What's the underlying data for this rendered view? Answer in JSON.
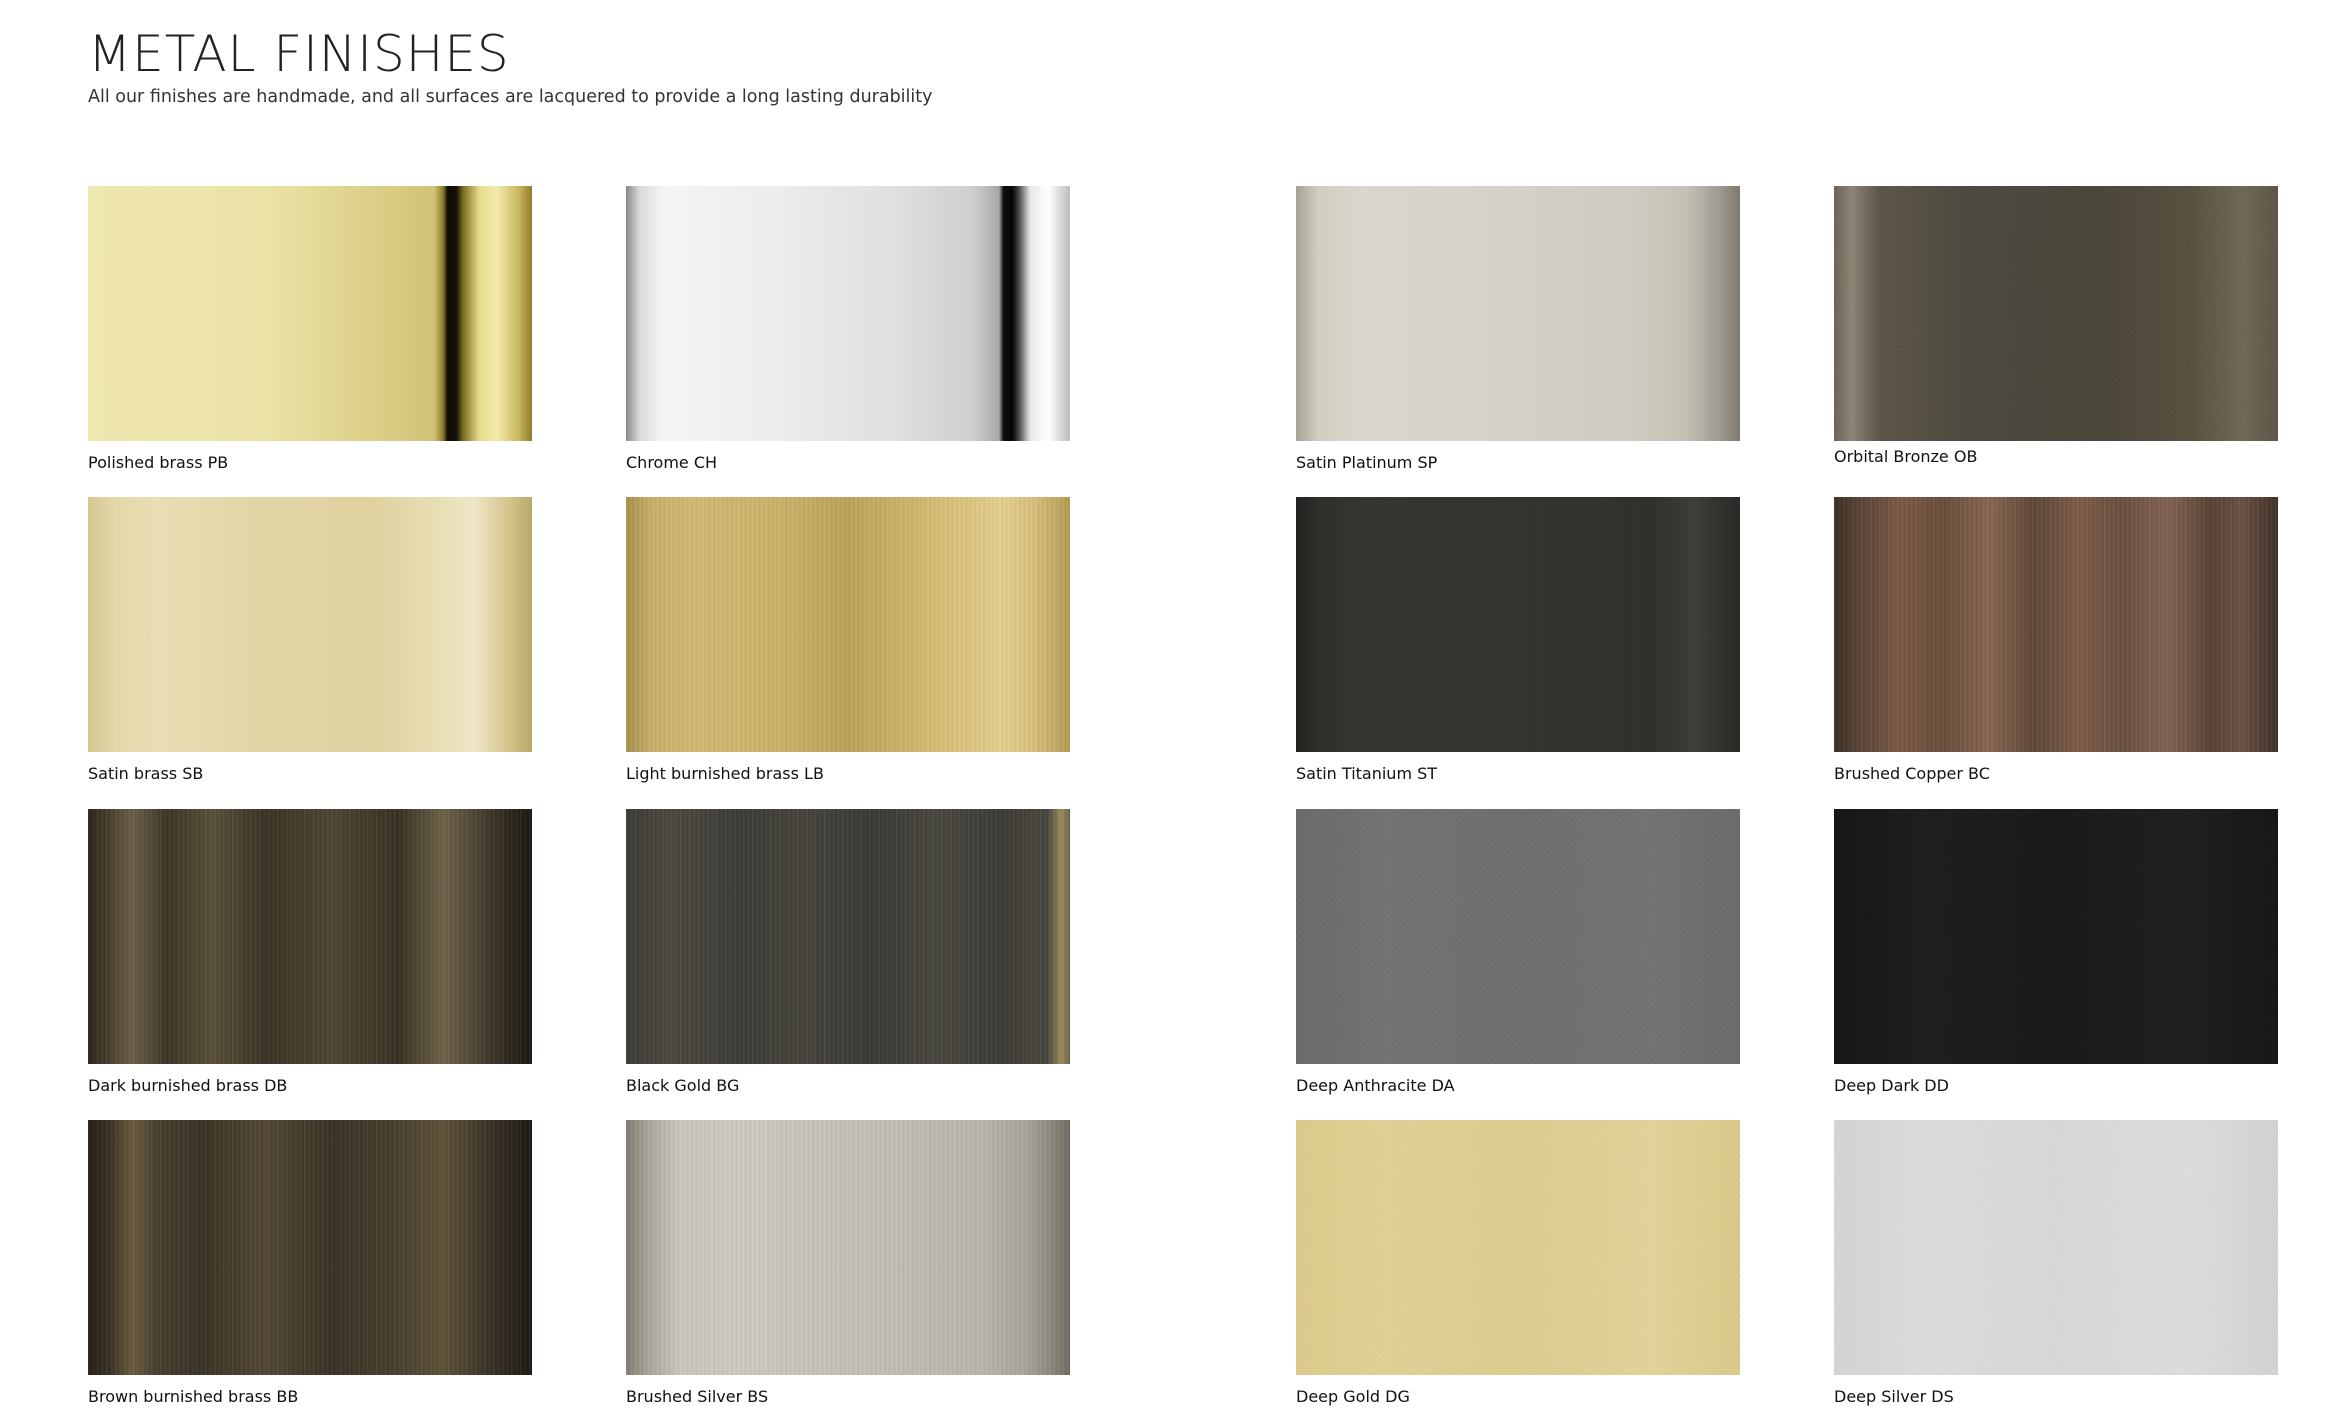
{
  "header": {
    "title": "METAL FINISHES",
    "subtitle": "All our finishes are handmade, and all surfaces are lacquered to provide a long lasting durability"
  },
  "finishes": [
    {
      "label": "Polished brass PB",
      "color": "#ebe2a6"
    },
    {
      "label": "Chrome CH",
      "color": "#eeeeee"
    },
    {
      "label": "Satin Platinum SP",
      "color": "#d8d5ca"
    },
    {
      "label": "Orbital Bronze OB",
      "color": "#4d483d"
    },
    {
      "label": "Satin brass SB",
      "color": "#e6d9a6"
    },
    {
      "label": "Light burnished brass LB",
      "color": "#cbb26a"
    },
    {
      "label": "Satin Titanium ST",
      "color": "#30312d"
    },
    {
      "label": "Brushed Copper BC",
      "color": "#6a4e3c"
    },
    {
      "label": "Dark burnished brass DB",
      "color": "#4a4130"
    },
    {
      "label": "Black Gold BG",
      "color": "#42403a"
    },
    {
      "label": "Deep Anthracite DA",
      "color": "#6e6d6f"
    },
    {
      "label": "Deep Dark DD",
      "color": "#181818"
    },
    {
      "label": "Brown burnished brass BB",
      "color": "#3f3628"
    },
    {
      "label": "Brushed Silver BS",
      "color": "#c5c2b8"
    },
    {
      "label": "Deep Gold DG",
      "color": "#ddcc8e"
    },
    {
      "label": "Deep Silver DS",
      "color": "#d8d8d6"
    }
  ]
}
